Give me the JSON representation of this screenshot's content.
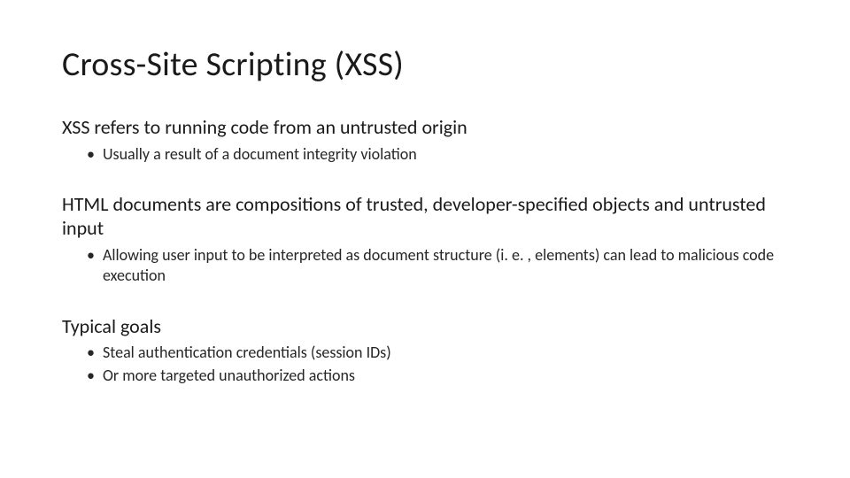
{
  "title": "Cross-Site Scripting (XSS)",
  "sections": [
    {
      "head": "XSS refers to running code from an untrusted origin",
      "bullets": [
        "Usually a result of a document integrity violation"
      ]
    },
    {
      "head": "HTML documents are compositions of trusted, developer-specified objects and untrusted input",
      "bullets": [
        "Allowing user input to be interpreted as document structure (i. e. , elements) can lead to malicious code execution"
      ]
    },
    {
      "head": "Typical goals",
      "bullets": [
        "Steal authentication credentials (session IDs)",
        "Or more targeted unauthorized actions"
      ]
    }
  ]
}
